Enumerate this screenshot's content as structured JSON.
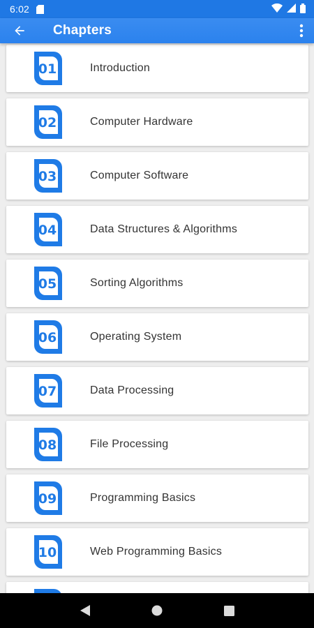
{
  "status_bar": {
    "time": "6:02",
    "icons": [
      "sd-card-icon",
      "wifi-icon",
      "signal-icon",
      "battery-icon"
    ]
  },
  "app_bar": {
    "title": "Chapters",
    "back_icon": "arrow-back-icon",
    "menu_icon": "more-vert-icon"
  },
  "chapters": [
    {
      "num": "01",
      "title": "Introduction"
    },
    {
      "num": "02",
      "title": "Computer Hardware"
    },
    {
      "num": "03",
      "title": "Computer Software"
    },
    {
      "num": "04",
      "title": "Data Structures & Algorithms"
    },
    {
      "num": "05",
      "title": "Sorting Algorithms"
    },
    {
      "num": "06",
      "title": "Operating System"
    },
    {
      "num": "07",
      "title": "Data Processing"
    },
    {
      "num": "08",
      "title": "File Processing"
    },
    {
      "num": "09",
      "title": "Programming Basics"
    },
    {
      "num": "10",
      "title": "Web Programming Basics"
    },
    {
      "num": "",
      "title": ""
    }
  ],
  "nav_bar": {
    "icons": [
      "back-triangle-icon",
      "home-circle-icon",
      "recents-square-icon"
    ]
  },
  "colors": {
    "accent": "#1f7be6",
    "app_bar": "#2b82ee",
    "status_bar": "#1f78e4"
  }
}
